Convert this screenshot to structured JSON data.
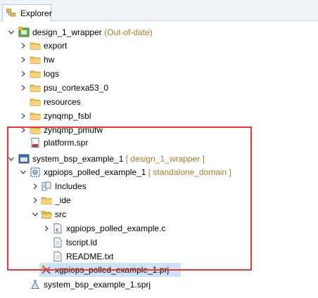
{
  "tab": {
    "label": "Explorer",
    "icon": "explorer-icon",
    "close": "⊠"
  },
  "tree": {
    "wrapper": {
      "name": "design_1_wrapper",
      "decoration": "(Out-of-date)"
    },
    "wrapper_children": [
      "export",
      "hw",
      "logs",
      "psu_cortexa53_0",
      "resources",
      "zynqmp_fsbl",
      "zynqmp_pmufw",
      "platform.spr"
    ],
    "system": {
      "name": "system_bsp_example_1",
      "decoration": "[ design_1_wrapper ]"
    },
    "app": {
      "name": "xgpiops_polled_example_1",
      "decoration": "[ standalone_domain ]"
    },
    "app_children": {
      "includes": "Includes",
      "ide": "_ide",
      "src": "src"
    },
    "src_children": {
      "c_file": "xgpiops_polled_example.c",
      "lscript": "lscript.ld",
      "readme": "README.txt"
    },
    "prj": "xgpiops_polled_example_1.prj",
    "sprj": "system_bsp_example_1.sprj"
  },
  "colors": {
    "highlight_border": "#e53935",
    "decoration": "#a67c2e",
    "selection": "#cfe3f7"
  }
}
